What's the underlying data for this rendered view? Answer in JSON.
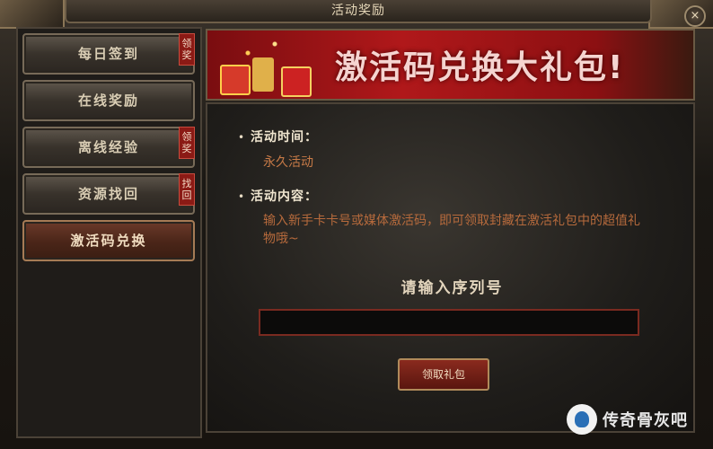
{
  "window": {
    "title": "活动奖励",
    "close_label": "×"
  },
  "sidebar": {
    "items": [
      {
        "label": "每日签到",
        "tag": "领奖"
      },
      {
        "label": "在线奖励",
        "tag": ""
      },
      {
        "label": "离线经验",
        "tag": "领奖"
      },
      {
        "label": "资源找回",
        "tag": "找回"
      },
      {
        "label": "激活码兑换",
        "tag": ""
      }
    ],
    "active_index": 4
  },
  "banner": {
    "title": "激活码兑换大礼包!"
  },
  "content": {
    "time_label": "活动时间：",
    "time_value": "永久活动",
    "content_label": "活动内容：",
    "content_value": "输入新手卡卡号或媒体激活码，即可领取封藏在激活礼包中的超值礼物哦~",
    "serial_title": "请输入序列号",
    "serial_value": "",
    "redeem_label": "领取礼包"
  },
  "watermark": {
    "text": "传奇骨灰吧"
  },
  "colors": {
    "accent_red": "#8b1a15",
    "highlight_orange": "#c77a47",
    "text_light": "#e3d5bd"
  }
}
